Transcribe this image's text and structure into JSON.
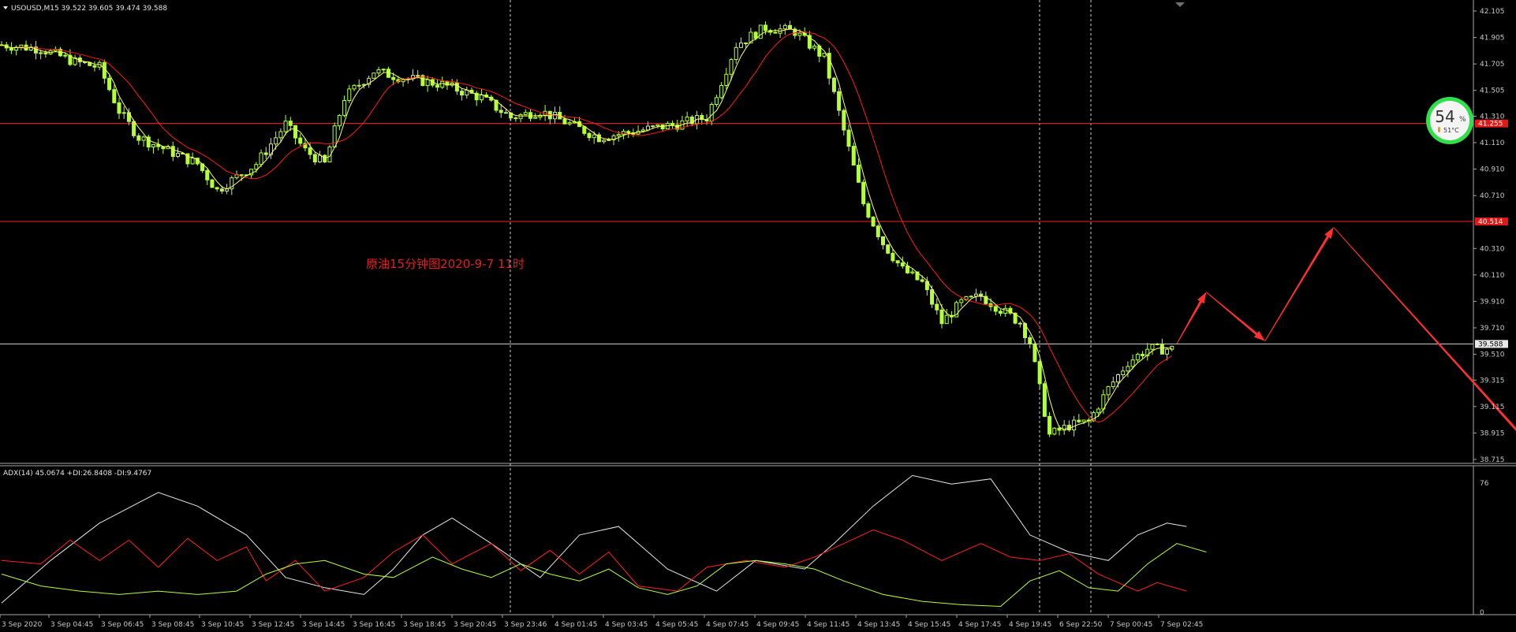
{
  "chart_data": [
    {
      "type": "candlestick",
      "title": "USOUSD,M15  39.522 39.605 39.474 39.588",
      "annotation": "原油15分钟图2020-9-7  11时",
      "ylim": [
        38.715,
        42.105
      ],
      "y_ticks": [
        "42.105",
        "41.905",
        "41.705",
        "41.505",
        "41.310",
        "41.110",
        "40.910",
        "40.710",
        "40.310",
        "40.110",
        "39.910",
        "39.710",
        "39.510",
        "39.315",
        "39.115",
        "38.915",
        "38.715"
      ],
      "x_labels": [
        "3 Sep 2020",
        "3 Sep 04:45",
        "3 Sep 06:45",
        "3 Sep 08:45",
        "3 Sep 10:45",
        "3 Sep 12:45",
        "3 Sep 14:45",
        "3 Sep 16:45",
        "3 Sep 18:45",
        "3 Sep 20:45",
        "3 Sep 23:46",
        "4 Sep 01:45",
        "4 Sep 03:45",
        "4 Sep 05:45",
        "4 Sep 07:45",
        "4 Sep 09:45",
        "4 Sep 11:45",
        "4 Sep 13:45",
        "4 Sep 15:45",
        "4 Sep 17:45",
        "4 Sep 19:45",
        "6 Sep 22:50",
        "7 Sep 00:45",
        "7 Sep 02:45"
      ],
      "bar_count": 240,
      "price_curve": [
        [
          0,
          41.85
        ],
        [
          8,
          41.82
        ],
        [
          15,
          41.72
        ],
        [
          20,
          41.68
        ],
        [
          24,
          41.35
        ],
        [
          28,
          41.15
        ],
        [
          34,
          41.05
        ],
        [
          40,
          40.95
        ],
        [
          44,
          40.75
        ],
        [
          48,
          40.85
        ],
        [
          52,
          40.95
        ],
        [
          58,
          41.25
        ],
        [
          62,
          41.05
        ],
        [
          66,
          40.95
        ],
        [
          70,
          41.45
        ],
        [
          76,
          41.65
        ],
        [
          82,
          41.6
        ],
        [
          90,
          41.55
        ],
        [
          98,
          41.45
        ],
        [
          104,
          41.3
        ],
        [
          110,
          41.35
        ],
        [
          116,
          41.25
        ],
        [
          122,
          41.15
        ],
        [
          130,
          41.2
        ],
        [
          138,
          41.25
        ],
        [
          144,
          41.3
        ],
        [
          150,
          41.85
        ],
        [
          156,
          41.98
        ],
        [
          162,
          41.95
        ],
        [
          168,
          41.75
        ],
        [
          172,
          41.2
        ],
        [
          176,
          40.65
        ],
        [
          180,
          40.35
        ],
        [
          184,
          40.15
        ],
        [
          188,
          40.05
        ],
        [
          192,
          39.75
        ],
        [
          196,
          39.9
        ],
        [
          200,
          39.95
        ],
        [
          204,
          39.85
        ],
        [
          208,
          39.75
        ],
        [
          210,
          39.6
        ],
        [
          214,
          38.9
        ],
        [
          218,
          38.97
        ],
        [
          222,
          39.0
        ],
        [
          226,
          39.25
        ],
        [
          230,
          39.45
        ],
        [
          234,
          39.55
        ],
        [
          238,
          39.55
        ]
      ],
      "fast_ma_color": "#ffff66",
      "slow_ma_color": "#ff1a1a",
      "h_lines": [
        {
          "price": 41.255,
          "label": "41.255",
          "color": "#ff2020"
        },
        {
          "price": 40.514,
          "label": "40.514",
          "color": "#ff2020"
        },
        {
          "price": 39.588,
          "label": "39.588",
          "color": "#c8c8c8"
        }
      ],
      "forecast_arrow_path_prices": [
        [
          240,
          39.59
        ],
        [
          246,
          39.98
        ],
        [
          258,
          39.61
        ],
        [
          272,
          40.47
        ],
        [
          312,
          38.83
        ]
      ],
      "forecast_arrow_color": "#ff3030",
      "gauge": {
        "percent": "54",
        "unit": "%",
        "temp": "51°C"
      }
    },
    {
      "type": "line",
      "title": "ADX(14) 45.0674 +DI:26.8408 -DI:9.4767",
      "ylim": [
        0,
        76
      ],
      "y_ticks": [
        "76",
        "0"
      ],
      "series": [
        {
          "name": "ADX",
          "color": "#e6e6e6",
          "points": [
            [
              0,
              5
            ],
            [
              10,
              30
            ],
            [
              20,
              52
            ],
            [
              32,
              70
            ],
            [
              40,
              62
            ],
            [
              50,
              45
            ],
            [
              58,
              20
            ],
            [
              66,
              14
            ],
            [
              74,
              10
            ],
            [
              80,
              25
            ],
            [
              86,
              45
            ],
            [
              92,
              55
            ],
            [
              100,
              40
            ],
            [
              110,
              20
            ],
            [
              118,
              45
            ],
            [
              126,
              50
            ],
            [
              136,
              25
            ],
            [
              146,
              12
            ],
            [
              154,
              30
            ],
            [
              164,
              25
            ],
            [
              170,
              40
            ],
            [
              178,
              62
            ],
            [
              186,
              80
            ],
            [
              194,
              75
            ],
            [
              202,
              78
            ],
            [
              210,
              45
            ],
            [
              218,
              35
            ],
            [
              226,
              30
            ],
            [
              232,
              45
            ],
            [
              238,
              52
            ],
            [
              242,
              50
            ]
          ]
        },
        {
          "name": "+DI",
          "color": "#ff2020",
          "points": [
            [
              0,
              30
            ],
            [
              8,
              28
            ],
            [
              14,
              42
            ],
            [
              20,
              30
            ],
            [
              26,
              42
            ],
            [
              32,
              26
            ],
            [
              38,
              43
            ],
            [
              44,
              30
            ],
            [
              50,
              38
            ],
            [
              54,
              18
            ],
            [
              60,
              30
            ],
            [
              66,
              12
            ],
            [
              74,
              20
            ],
            [
              80,
              35
            ],
            [
              86,
              45
            ],
            [
              92,
              28
            ],
            [
              100,
              40
            ],
            [
              106,
              24
            ],
            [
              112,
              36
            ],
            [
              118,
              22
            ],
            [
              124,
              35
            ],
            [
              130,
              15
            ],
            [
              138,
              12
            ],
            [
              144,
              26
            ],
            [
              152,
              30
            ],
            [
              160,
              26
            ],
            [
              166,
              32
            ],
            [
              172,
              40
            ],
            [
              178,
              48
            ],
            [
              184,
              42
            ],
            [
              192,
              30
            ],
            [
              200,
              40
            ],
            [
              206,
              32
            ],
            [
              212,
              30
            ],
            [
              218,
              34
            ],
            [
              224,
              22
            ],
            [
              232,
              12
            ],
            [
              236,
              17
            ],
            [
              242,
              12
            ]
          ]
        },
        {
          "name": "-DI",
          "color": "#b4ff3c",
          "points": [
            [
              0,
              22
            ],
            [
              8,
              15
            ],
            [
              16,
              12
            ],
            [
              24,
              10
            ],
            [
              32,
              12
            ],
            [
              40,
              10
            ],
            [
              48,
              12
            ],
            [
              54,
              22
            ],
            [
              60,
              28
            ],
            [
              66,
              30
            ],
            [
              74,
              22
            ],
            [
              80,
              20
            ],
            [
              88,
              32
            ],
            [
              94,
              25
            ],
            [
              100,
              20
            ],
            [
              106,
              28
            ],
            [
              112,
              22
            ],
            [
              118,
              18
            ],
            [
              124,
              25
            ],
            [
              130,
              14
            ],
            [
              136,
              10
            ],
            [
              142,
              15
            ],
            [
              148,
              28
            ],
            [
              154,
              30
            ],
            [
              160,
              28
            ],
            [
              166,
              25
            ],
            [
              172,
              18
            ],
            [
              180,
              10
            ],
            [
              188,
              6
            ],
            [
              196,
              4
            ],
            [
              204,
              3
            ],
            [
              210,
              18
            ],
            [
              216,
              24
            ],
            [
              222,
              14
            ],
            [
              228,
              12
            ],
            [
              234,
              28
            ],
            [
              240,
              40
            ],
            [
              246,
              35
            ]
          ]
        }
      ]
    }
  ]
}
